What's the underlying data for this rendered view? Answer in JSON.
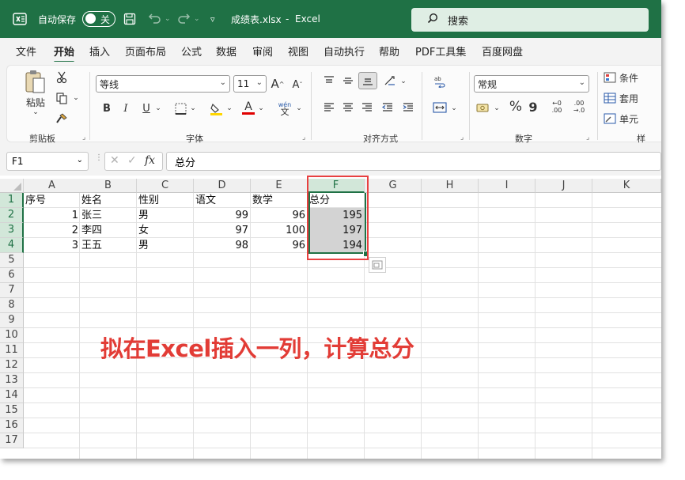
{
  "titlebar": {
    "autosave_label": "自动保存",
    "autosave_state": "关",
    "filename": "成绩表.xlsx",
    "separator": "-",
    "app_name": "Excel",
    "search_placeholder": "搜索",
    "bg_color": "#1f7145"
  },
  "menu": {
    "items": [
      "文件",
      "开始",
      "插入",
      "页面布局",
      "公式",
      "数据",
      "审阅",
      "视图",
      "自动执行",
      "帮助",
      "PDF工具集",
      "百度网盘"
    ],
    "active": "开始"
  },
  "ribbon": {
    "clipboard": {
      "paste_label": "粘贴",
      "group_label": "剪贴板"
    },
    "font": {
      "font_name": "等线",
      "font_size": "11",
      "group_label": "字体",
      "bold": "B",
      "italic": "I",
      "underline": "U",
      "grow": "A",
      "shrink": "A",
      "phonetic_top": "wén",
      "phonetic_bottom": "文"
    },
    "alignment": {
      "group_label": "对齐方式"
    },
    "number": {
      "format": "常规",
      "group_label": "数字",
      "percent": "%",
      "comma": "9",
      "inc_dec_top": "←0",
      "inc_dec_bottom": ".00",
      "dec_dec_top": ".00",
      "dec_dec_bottom": "→.0"
    },
    "styles": {
      "conditional": "条件",
      "table": "套用",
      "cell": "单元",
      "group_label": "样"
    }
  },
  "formula_bar": {
    "name_box": "F1",
    "fx": "fx",
    "value": "总分"
  },
  "grid": {
    "columns": [
      "A",
      "B",
      "C",
      "D",
      "E",
      "F",
      "G",
      "H",
      "I",
      "J",
      "K"
    ],
    "selected_column": "F",
    "row_numbers": [
      "1",
      "2",
      "3",
      "4",
      "5",
      "6",
      "7",
      "8",
      "9",
      "10",
      "11",
      "12",
      "13",
      "14",
      "15",
      "16",
      "17"
    ],
    "rows": [
      {
        "A": "序号",
        "B": "姓名",
        "C": "性别",
        "D": "语文",
        "E": "数学",
        "F": "总分"
      },
      {
        "A": "1",
        "B": "张三",
        "C": "男",
        "D": "99",
        "E": "96",
        "F": "195"
      },
      {
        "A": "2",
        "B": "李四",
        "C": "女",
        "D": "97",
        "E": "100",
        "F": "197"
      },
      {
        "A": "3",
        "B": "王五",
        "C": "男",
        "D": "98",
        "E": "96",
        "F": "194"
      }
    ]
  },
  "annotation": "拟在Excel插入一列，计算总分",
  "colors": {
    "accent": "#1f7145",
    "highlight_box": "#e84040",
    "annotation": "#e23c36"
  }
}
